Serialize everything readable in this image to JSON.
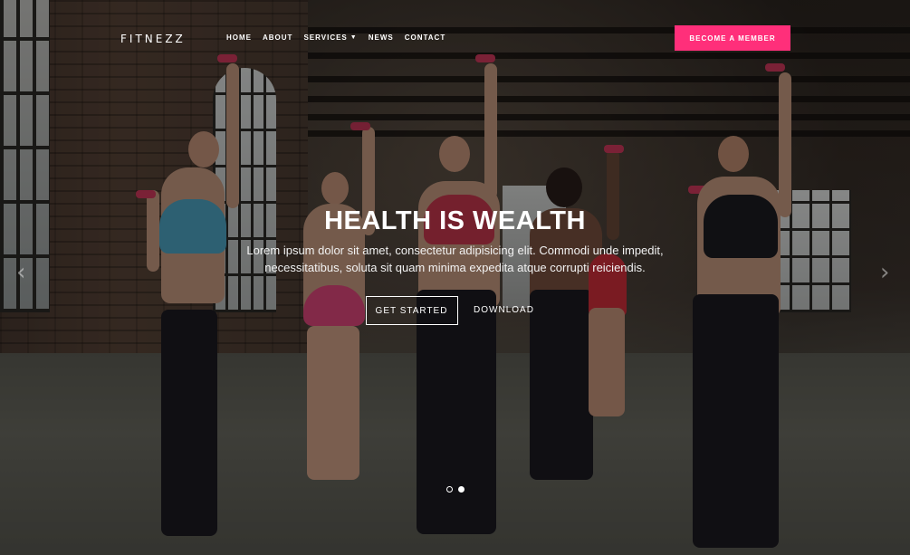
{
  "brand": {
    "logo": "FITNEZZ"
  },
  "nav": {
    "items": [
      {
        "label": "HOME"
      },
      {
        "label": "ABOUT"
      },
      {
        "label": "SERVICES",
        "has_dropdown": true
      },
      {
        "label": "NEWS"
      },
      {
        "label": "CONTACT"
      }
    ],
    "cta_label": "BECOME A MEMBER"
  },
  "hero": {
    "title": "HEALTH IS WEALTH",
    "text": "Lorem ipsum dolor sit amet, consectetur adipisicing elit. Commodi unde impedit, necessitatibus, soluta sit quam minima expedita atque corrupti reiciendis.",
    "primary_button": "GET STARTED",
    "secondary_button": "DOWNLOAD",
    "slides": 2,
    "active_slide": 2
  },
  "icons": {
    "prev": "chevron-left-icon",
    "next": "chevron-right-icon"
  },
  "colors": {
    "accent": "#ff2f7a",
    "text": "#ffffff"
  }
}
